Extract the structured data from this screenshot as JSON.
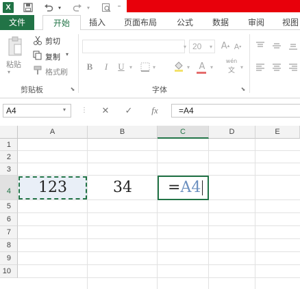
{
  "qat": {
    "app_icon": "X",
    "icons": [
      "save-icon",
      "undo-icon",
      "redo-icon",
      "print-preview-icon"
    ]
  },
  "tabs": [
    "文件",
    "开始",
    "插入",
    "页面布局",
    "公式",
    "数据",
    "审阅",
    "视图"
  ],
  "ribbon": {
    "clipboard": {
      "paste_label": "粘贴",
      "cut_label": "剪切",
      "copy_label": "复制",
      "format_painter_label": "格式刷",
      "group_label": "剪贴板"
    },
    "font": {
      "font_name": "",
      "font_size": "20",
      "bold": "B",
      "italic": "I",
      "underline": "U",
      "phonetic": "wén",
      "group_label": "字体"
    }
  },
  "formula_bar": {
    "name_box": "A4",
    "cancel": "✕",
    "enter": "✓",
    "fx": "fx",
    "formula": "=A4"
  },
  "sheet": {
    "columns": [
      "A",
      "B",
      "C",
      "D",
      "E"
    ],
    "selected_column": "C",
    "rows": [
      "1",
      "2",
      "3",
      "4",
      "5",
      "6",
      "7",
      "8",
      "9",
      "10"
    ],
    "selected_row": "4",
    "cells": {
      "A4": "123",
      "B4": "34",
      "C4_prefix": "=",
      "C4_ref": "A4"
    }
  },
  "colors": {
    "accent": "#217346",
    "highlight_bar": "#e8000b",
    "reference": "#6a8fbf"
  }
}
